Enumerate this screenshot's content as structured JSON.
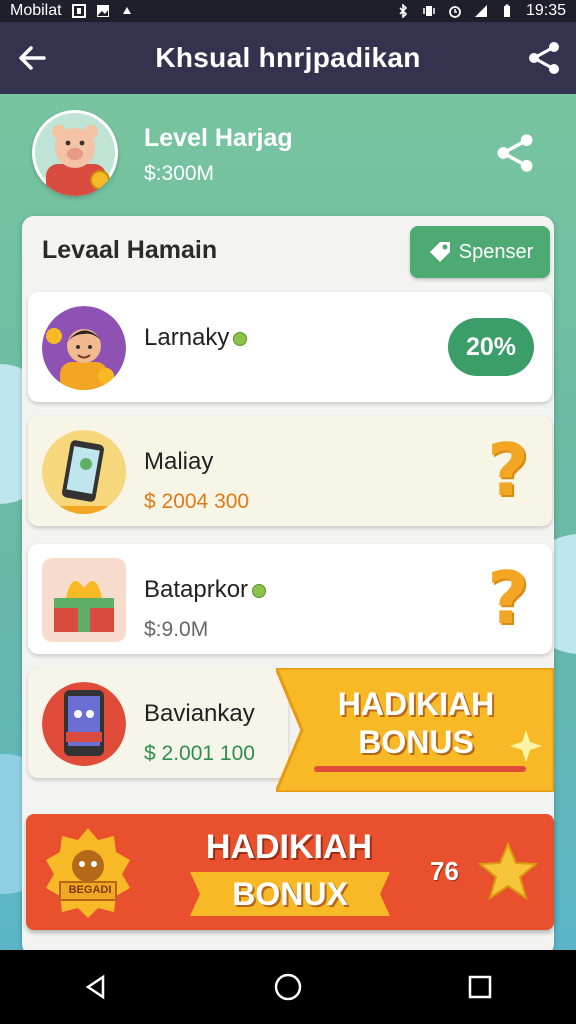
{
  "status_bar": {
    "carrier": "Mobilat",
    "time": "19:35"
  },
  "app_bar": {
    "title": "Khsual hnrjpadikan",
    "back_icon": "back-arrow-icon",
    "share_icon": "share-icon"
  },
  "profile": {
    "title": "Level Harjag",
    "subtitle": "$:300M"
  },
  "list": {
    "title": "Levaal Hamain",
    "sponsor_label": "Spenser",
    "items": [
      {
        "name": "Larnaky",
        "amount": "",
        "badge": "20%",
        "accent": "#3b9d68"
      },
      {
        "name": "Maliay",
        "amount": "$ 2004 300",
        "amount_color": "#e07a1a"
      },
      {
        "name": "Bataprkor",
        "amount": "$:9.0M",
        "amount_color": "#666666"
      },
      {
        "name": "Baviankay",
        "amount": "$ 2.001 100",
        "amount_color": "#2f8f4e"
      }
    ]
  },
  "bonus_ribbon": {
    "line1": "HADIKIAH",
    "line2": "BONUS"
  },
  "bonus_bar": {
    "line1": "HADIKIAH",
    "line2": "BONUX",
    "badge_text": "76",
    "badge_label": "BEGADI"
  },
  "colors": {
    "appbar": "#33334f",
    "accent_green": "#4caa72",
    "bonus_orange": "#e8502e",
    "bonus_yellow": "#f7b925"
  }
}
